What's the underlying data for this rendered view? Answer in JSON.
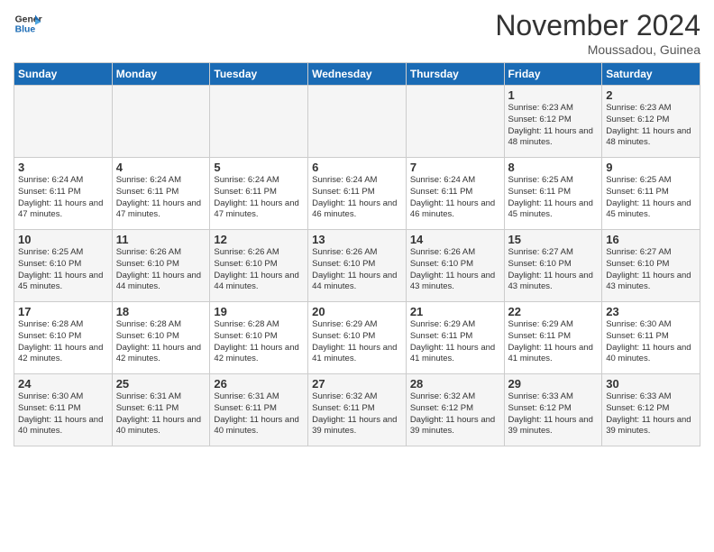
{
  "header": {
    "logo_line1": "General",
    "logo_line2": "Blue",
    "month_title": "November 2024",
    "location": "Moussadou, Guinea"
  },
  "weekdays": [
    "Sunday",
    "Monday",
    "Tuesday",
    "Wednesday",
    "Thursday",
    "Friday",
    "Saturday"
  ],
  "weeks": [
    [
      {
        "day": "",
        "info": ""
      },
      {
        "day": "",
        "info": ""
      },
      {
        "day": "",
        "info": ""
      },
      {
        "day": "",
        "info": ""
      },
      {
        "day": "",
        "info": ""
      },
      {
        "day": "1",
        "info": "Sunrise: 6:23 AM\nSunset: 6:12 PM\nDaylight: 11 hours and 48 minutes."
      },
      {
        "day": "2",
        "info": "Sunrise: 6:23 AM\nSunset: 6:12 PM\nDaylight: 11 hours and 48 minutes."
      }
    ],
    [
      {
        "day": "3",
        "info": "Sunrise: 6:24 AM\nSunset: 6:11 PM\nDaylight: 11 hours and 47 minutes."
      },
      {
        "day": "4",
        "info": "Sunrise: 6:24 AM\nSunset: 6:11 PM\nDaylight: 11 hours and 47 minutes."
      },
      {
        "day": "5",
        "info": "Sunrise: 6:24 AM\nSunset: 6:11 PM\nDaylight: 11 hours and 47 minutes."
      },
      {
        "day": "6",
        "info": "Sunrise: 6:24 AM\nSunset: 6:11 PM\nDaylight: 11 hours and 46 minutes."
      },
      {
        "day": "7",
        "info": "Sunrise: 6:24 AM\nSunset: 6:11 PM\nDaylight: 11 hours and 46 minutes."
      },
      {
        "day": "8",
        "info": "Sunrise: 6:25 AM\nSunset: 6:11 PM\nDaylight: 11 hours and 45 minutes."
      },
      {
        "day": "9",
        "info": "Sunrise: 6:25 AM\nSunset: 6:11 PM\nDaylight: 11 hours and 45 minutes."
      }
    ],
    [
      {
        "day": "10",
        "info": "Sunrise: 6:25 AM\nSunset: 6:10 PM\nDaylight: 11 hours and 45 minutes."
      },
      {
        "day": "11",
        "info": "Sunrise: 6:26 AM\nSunset: 6:10 PM\nDaylight: 11 hours and 44 minutes."
      },
      {
        "day": "12",
        "info": "Sunrise: 6:26 AM\nSunset: 6:10 PM\nDaylight: 11 hours and 44 minutes."
      },
      {
        "day": "13",
        "info": "Sunrise: 6:26 AM\nSunset: 6:10 PM\nDaylight: 11 hours and 44 minutes."
      },
      {
        "day": "14",
        "info": "Sunrise: 6:26 AM\nSunset: 6:10 PM\nDaylight: 11 hours and 43 minutes."
      },
      {
        "day": "15",
        "info": "Sunrise: 6:27 AM\nSunset: 6:10 PM\nDaylight: 11 hours and 43 minutes."
      },
      {
        "day": "16",
        "info": "Sunrise: 6:27 AM\nSunset: 6:10 PM\nDaylight: 11 hours and 43 minutes."
      }
    ],
    [
      {
        "day": "17",
        "info": "Sunrise: 6:28 AM\nSunset: 6:10 PM\nDaylight: 11 hours and 42 minutes."
      },
      {
        "day": "18",
        "info": "Sunrise: 6:28 AM\nSunset: 6:10 PM\nDaylight: 11 hours and 42 minutes."
      },
      {
        "day": "19",
        "info": "Sunrise: 6:28 AM\nSunset: 6:10 PM\nDaylight: 11 hours and 42 minutes."
      },
      {
        "day": "20",
        "info": "Sunrise: 6:29 AM\nSunset: 6:10 PM\nDaylight: 11 hours and 41 minutes."
      },
      {
        "day": "21",
        "info": "Sunrise: 6:29 AM\nSunset: 6:11 PM\nDaylight: 11 hours and 41 minutes."
      },
      {
        "day": "22",
        "info": "Sunrise: 6:29 AM\nSunset: 6:11 PM\nDaylight: 11 hours and 41 minutes."
      },
      {
        "day": "23",
        "info": "Sunrise: 6:30 AM\nSunset: 6:11 PM\nDaylight: 11 hours and 40 minutes."
      }
    ],
    [
      {
        "day": "24",
        "info": "Sunrise: 6:30 AM\nSunset: 6:11 PM\nDaylight: 11 hours and 40 minutes."
      },
      {
        "day": "25",
        "info": "Sunrise: 6:31 AM\nSunset: 6:11 PM\nDaylight: 11 hours and 40 minutes."
      },
      {
        "day": "26",
        "info": "Sunrise: 6:31 AM\nSunset: 6:11 PM\nDaylight: 11 hours and 40 minutes."
      },
      {
        "day": "27",
        "info": "Sunrise: 6:32 AM\nSunset: 6:11 PM\nDaylight: 11 hours and 39 minutes."
      },
      {
        "day": "28",
        "info": "Sunrise: 6:32 AM\nSunset: 6:12 PM\nDaylight: 11 hours and 39 minutes."
      },
      {
        "day": "29",
        "info": "Sunrise: 6:33 AM\nSunset: 6:12 PM\nDaylight: 11 hours and 39 minutes."
      },
      {
        "day": "30",
        "info": "Sunrise: 6:33 AM\nSunset: 6:12 PM\nDaylight: 11 hours and 39 minutes."
      }
    ]
  ]
}
